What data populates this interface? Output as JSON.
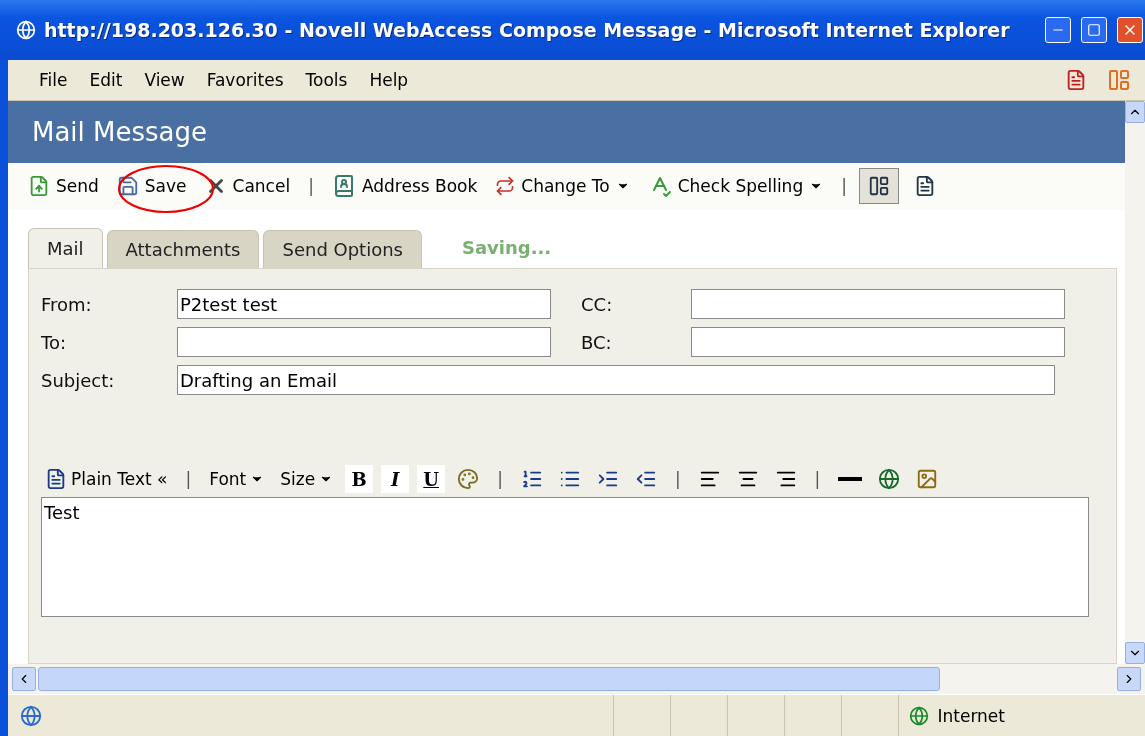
{
  "window": {
    "title": "http://198.203.126.30 - Novell WebAccess Compose Message - Microsoft Internet Explorer"
  },
  "menu": [
    "File",
    "Edit",
    "View",
    "Favorites",
    "Tools",
    "Help"
  ],
  "header": {
    "title": "Mail Message"
  },
  "toolbar": [
    {
      "kind": "button",
      "label": "Send"
    },
    {
      "kind": "button",
      "label": "Save"
    },
    {
      "kind": "button",
      "label": "Cancel"
    },
    {
      "kind": "separator",
      "label": "|"
    },
    {
      "kind": "button",
      "label": "Address Book"
    },
    {
      "kind": "dropdown",
      "label": "Change To"
    },
    {
      "kind": "dropdown",
      "label": "Check Spelling"
    },
    {
      "kind": "separator",
      "label": "|"
    },
    {
      "kind": "toggle",
      "selected": true
    },
    {
      "kind": "toggle",
      "selected": false
    }
  ],
  "tabs": [
    {
      "label": "Mail",
      "selected": true
    },
    {
      "label": "Attachments",
      "selected": false
    },
    {
      "label": "Send Options",
      "selected": false
    }
  ],
  "status_message": "Saving...",
  "fields": [
    {
      "label": "From:",
      "value": "P2test test",
      "cc_label": "CC:"
    },
    {
      "label": "To:",
      "cc_label": "BC:"
    }
  ],
  "subject": {
    "label": "Subject:",
    "value": "Drafting an Email"
  },
  "editor_toolbar": [
    {
      "kind": "text",
      "label": "Plain Text «"
    },
    {
      "kind": "separator",
      "label": "|"
    },
    {
      "kind": "dropdown",
      "label": "Font"
    },
    {
      "kind": "dropdown",
      "label": "Size"
    },
    {
      "kind": "format",
      "label": "B"
    },
    {
      "kind": "format",
      "label": "I"
    },
    {
      "kind": "format",
      "label": "U"
    },
    {
      "kind": "icon"
    },
    {
      "kind": "separator",
      "label": "|"
    },
    {
      "kind": "icon"
    },
    {
      "kind": "icon"
    },
    {
      "kind": "icon"
    },
    {
      "kind": "icon"
    },
    {
      "kind": "separator",
      "label": "|"
    },
    {
      "kind": "icon"
    },
    {
      "kind": "icon"
    },
    {
      "kind": "icon"
    },
    {
      "kind": "separator",
      "label": "|"
    },
    {
      "kind": "icon"
    },
    {
      "kind": "icon"
    },
    {
      "kind": "icon"
    }
  ],
  "body": "Test",
  "status_bar": {
    "zone": "Internet"
  }
}
